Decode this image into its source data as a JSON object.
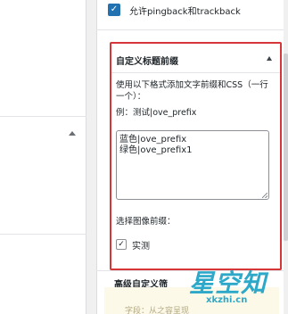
{
  "pingback": {
    "label": "允许pingback和trackback",
    "checked": true
  },
  "panel": {
    "title": "自定义标题前缀",
    "description": "使用以下格式添加文字前缀和CSS（一行一个）：",
    "example": "例：测试|ove_prefix",
    "textarea_lines": [
      "蓝色|ove_prefix",
      "绿色|ove_prefix1"
    ],
    "image_prefix_label": "选择图像前缀：",
    "test_option": {
      "label": "实测",
      "checked": true
    }
  },
  "advanced": {
    "title": "高级自定义筛"
  },
  "yellow_notice": {
    "text": "字段：从之容呈现"
  },
  "watermark": {
    "text": "星空知",
    "url": "xkzhi.cn"
  },
  "colors": {
    "highlight": "#d63638",
    "accent": "#2271b1",
    "watermark": "#2da8c9"
  }
}
